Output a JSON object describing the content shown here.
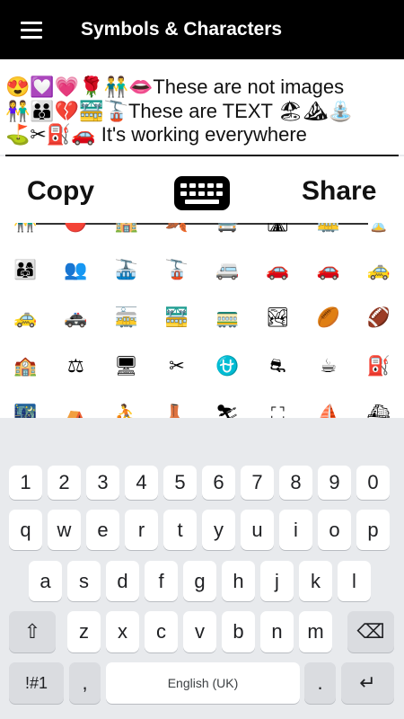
{
  "app": {
    "title": "Symbols & Characters"
  },
  "editor": {
    "lines": [
      "😍💟💗🌹👬👄These are not images",
      "👫👪💔🚟🚡These are TEXT 🏖⛰⛲",
      "⛳✂⛽🚗 It's working everywhere"
    ]
  },
  "actions": {
    "copy_label": "Copy",
    "share_label": "Share"
  },
  "emoji_grid": {
    "rows": [
      [
        "👬",
        "🔴",
        "🏫",
        "🍂",
        "🚍",
        "🛣",
        "🚋",
        "⏳"
      ],
      [
        "👨‍👩‍👧",
        "👥",
        "🚠",
        "🚡",
        "🚐",
        "🚗",
        "🚗",
        "🚕"
      ],
      [
        "🚕",
        "🚓",
        "🚋",
        "🚟",
        "🚃",
        "🏞",
        "🏉",
        "🏈"
      ],
      [
        "🏫",
        "⚖",
        "🖥",
        "✂",
        "⛎",
        "⛐",
        "☕",
        "⛽"
      ],
      [
        "🌃",
        "⛺",
        "⛹",
        "👢",
        "⛷",
        "⛶",
        "⛵",
        "⛴"
      ]
    ]
  },
  "keyboard": {
    "number_row": [
      "1",
      "2",
      "3",
      "4",
      "5",
      "6",
      "7",
      "8",
      "9",
      "0"
    ],
    "row1": [
      "q",
      "w",
      "e",
      "r",
      "t",
      "y",
      "u",
      "i",
      "o",
      "p"
    ],
    "row2": [
      "a",
      "s",
      "d",
      "f",
      "g",
      "h",
      "j",
      "k",
      "l"
    ],
    "row3": [
      "z",
      "x",
      "c",
      "v",
      "b",
      "n",
      "m"
    ],
    "shift_icon": "⇧",
    "backspace_icon": "⌫",
    "symbols_label": "!#1",
    "comma": ",",
    "space_label": "English (UK)",
    "period": ".",
    "enter_icon": "↵"
  }
}
